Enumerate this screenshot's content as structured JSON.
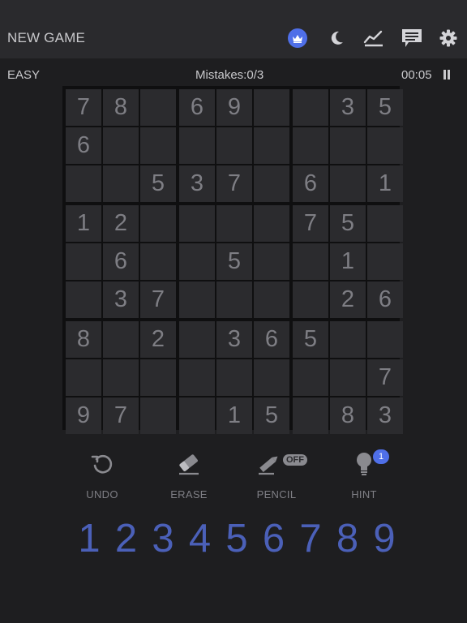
{
  "header": {
    "new_game_label": "NEW GAME",
    "icons": [
      "crown-icon",
      "moon-icon",
      "stats-icon",
      "chat-icon",
      "gear-icon"
    ],
    "accent_color": "#4f6fe8"
  },
  "status": {
    "difficulty": "EASY",
    "mistakes": "Mistakes:0/3",
    "timer": "00:05"
  },
  "board": [
    [
      "7",
      "8",
      "",
      "6",
      "9",
      "",
      "",
      "3",
      "5"
    ],
    [
      "6",
      "",
      "",
      "",
      "",
      "",
      "",
      "",
      ""
    ],
    [
      "",
      "",
      "5",
      "3",
      "7",
      "",
      "6",
      "",
      "1"
    ],
    [
      "1",
      "2",
      "",
      "",
      "",
      "",
      "7",
      "5",
      ""
    ],
    [
      "",
      "6",
      "",
      "",
      "5",
      "",
      "",
      "1",
      ""
    ],
    [
      "",
      "3",
      "7",
      "",
      "",
      "",
      "",
      "2",
      "6"
    ],
    [
      "8",
      "",
      "2",
      "",
      "3",
      "6",
      "5",
      "",
      ""
    ],
    [
      "",
      "",
      "",
      "",
      "",
      "",
      "",
      "",
      "7"
    ],
    [
      "9",
      "7",
      "",
      "",
      "1",
      "5",
      "",
      "8",
      "3"
    ]
  ],
  "tools": {
    "undo": "UNDO",
    "erase": "ERASE",
    "pencil": "PENCIL",
    "pencil_state": "OFF",
    "hint": "HINT",
    "hint_count": "1"
  },
  "numbers": [
    "1",
    "2",
    "3",
    "4",
    "5",
    "6",
    "7",
    "8",
    "9"
  ],
  "number_color": "#4b60b8"
}
